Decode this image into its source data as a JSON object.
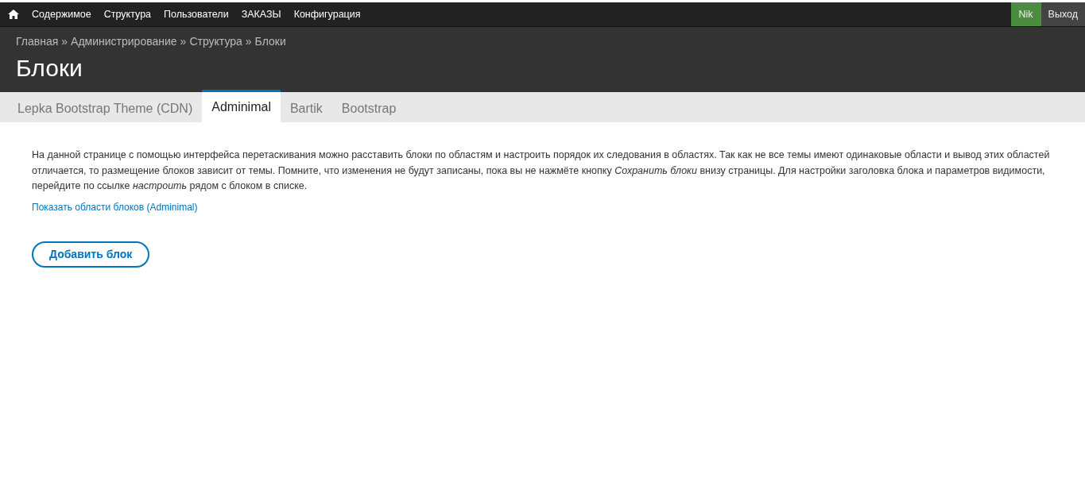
{
  "toolbar": {
    "menu": [
      {
        "label": "Содержимое"
      },
      {
        "label": "Структура"
      },
      {
        "label": "Пользователи"
      },
      {
        "label": "ЗАКАЗЫ"
      },
      {
        "label": "Конфигурация"
      }
    ],
    "user": "Nik",
    "logout": "Выход"
  },
  "breadcrumb": [
    "Главная",
    "Администрирование",
    "Структура",
    "Блоки"
  ],
  "breadcrumb_separator": "»",
  "title": "Блоки",
  "tabs": [
    {
      "label": "Lepka Bootstrap Theme (CDN)",
      "selected": false
    },
    {
      "label": "Adminimal",
      "selected": true
    },
    {
      "label": "Bartik",
      "selected": false
    },
    {
      "label": "Bootstrap",
      "selected": false
    }
  ],
  "description": "На данной странице с помощью интерфейса перетаскивания можно расставить блоки по областям и настроить порядок их следования в областях. Так как не все темы имеют одинаковые области и вывод этих областей отличается, то размещение блоков зависит от темы. Помните, что изменения не будут записаны, пока вы не нажмёте кнопку *Сохранить блоки* внизу страницы. Для настройки заголовка блока и параметров видимости, перейдите по ссылке *настроить* рядом с блоком в списке.",
  "demo_link": "Показать области блоков (Adminimal)",
  "add_button": "Добавить блок"
}
